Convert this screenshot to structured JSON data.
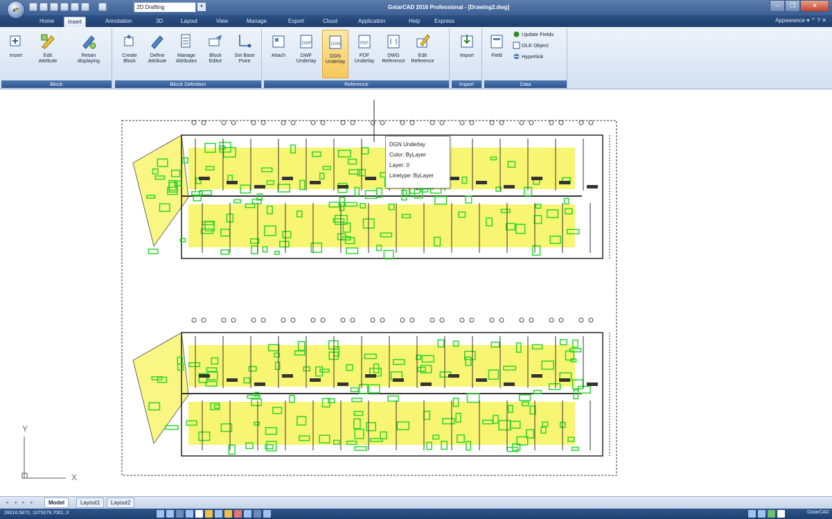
{
  "titlebar": {
    "title": "GstarCAD 2016 Professional - [Drawing2.dwg]",
    "workspace": "2D Drafting"
  },
  "tabs": [
    {
      "label": "Home"
    },
    {
      "label": "Insert"
    },
    {
      "label": "Annotation"
    },
    {
      "label": "3D"
    },
    {
      "label": "Layout"
    },
    {
      "label": "View"
    },
    {
      "label": "Manage"
    },
    {
      "label": "Export"
    },
    {
      "label": "Cloud"
    },
    {
      "label": "Application"
    },
    {
      "label": "Help"
    },
    {
      "label": "Express"
    }
  ],
  "active_tab": "Insert",
  "appearance_label": "Appearance",
  "ribbon": {
    "groups": [
      {
        "label": "Block"
      },
      {
        "label": "Block Definition"
      },
      {
        "label": "Reference"
      },
      {
        "label": "Import"
      },
      {
        "label": "Data"
      }
    ],
    "buttons": {
      "insert": "Insert",
      "edit_attribute": "Edit Attribute",
      "retain_displaying": "Retain displaying",
      "create_block": "Create Block",
      "define_attribute": "Define Attribute",
      "manage_attributes": "Manage Attributes",
      "block_editor": "Block Editor",
      "set_base_point": "Set Base Point",
      "attach": "Attach",
      "dwf_underlay": "DWF Underlay",
      "dgn_underlay": "DGN Underlay",
      "pdf_underlay": "PDF Underlay",
      "dwg_reference": "DWG Reference",
      "edit_reference": "Edit Reference",
      "import": "Import",
      "field": "Field",
      "update_fields": "Update Fields",
      "ole_object": "OLE Object",
      "hyperlink": "Hyperlink"
    }
  },
  "tooltip": {
    "title": "DGN Underlay",
    "color": "Color: ByLayer",
    "layer": "Layer: 0",
    "linetype": "Linetype: ByLayer"
  },
  "ucs": {
    "x": "X",
    "y": "Y"
  },
  "layout_tabs": [
    {
      "label": "Model"
    },
    {
      "label": "Layout1"
    },
    {
      "label": "Layout2"
    }
  ],
  "status": {
    "coordinates": "28016.5872, 1075679.7061, 0",
    "app": "GstarCAD"
  },
  "colors": {
    "underlay_yellow": "#f7f35a",
    "underlay_green": "#2bd52b",
    "ribbon_blue": "#2c5590",
    "title_blue": "#3b5f94"
  }
}
